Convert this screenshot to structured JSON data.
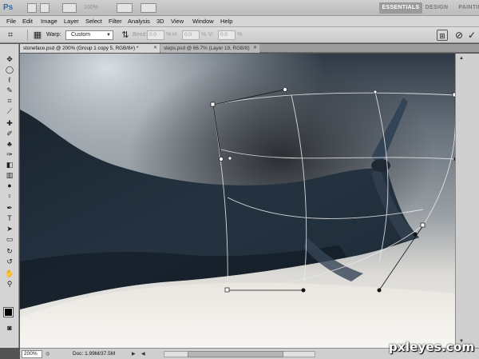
{
  "appbar": {
    "logo": "Ps",
    "zoom": "100%",
    "workspaces": [
      "ESSENTIALS",
      "DESIGN",
      "PAINTING"
    ]
  },
  "menu": [
    "File",
    "Edit",
    "Image",
    "Layer",
    "Select",
    "Filter",
    "Analysis",
    "3D",
    "View",
    "Window",
    "Help"
  ],
  "options": {
    "warp_label": "Warp:",
    "warp_value": "Custom",
    "bend_label": "Bend:",
    "bend_value": "0.0",
    "bend_unit": "%",
    "h_label": "H:",
    "h_value": "0.0",
    "h_unit": "%",
    "v_label": "V:",
    "v_value": "0.0",
    "v_unit": "%"
  },
  "tabs": [
    {
      "label": "stoneface.psd @ 200% (Group 1 copy 5, RGB/8#) *",
      "active": true
    },
    {
      "label": "steps.psd @ 66.7% (Layer 19, RGB/8)",
      "active": false
    }
  ],
  "status": {
    "zoom": "200%",
    "doc": "Doc: 1.99M/37.5M"
  },
  "watermark": "pxleyes.com",
  "colors": {
    "foreground": "#000000",
    "background": "#000000",
    "panel": "#d4d4d4",
    "workspace_active": "#9a9a9a"
  },
  "icons": {
    "toolbar": [
      "move-icon",
      "marquee-icon",
      "lasso-icon",
      "quick-select-icon",
      "crop-icon",
      "eyedropper-icon",
      "healing-icon",
      "brush-icon",
      "clone-stamp-icon",
      "history-brush-icon",
      "eraser-icon",
      "gradient-icon",
      "blur-icon",
      "dodge-icon",
      "pen-icon",
      "type-icon",
      "path-select-icon",
      "shape-icon",
      "3d-rotate-icon",
      "3d-orbit-icon",
      "hand-icon",
      "zoom-icon",
      "quick-mask-icon",
      "screen-mode-icon"
    ]
  }
}
